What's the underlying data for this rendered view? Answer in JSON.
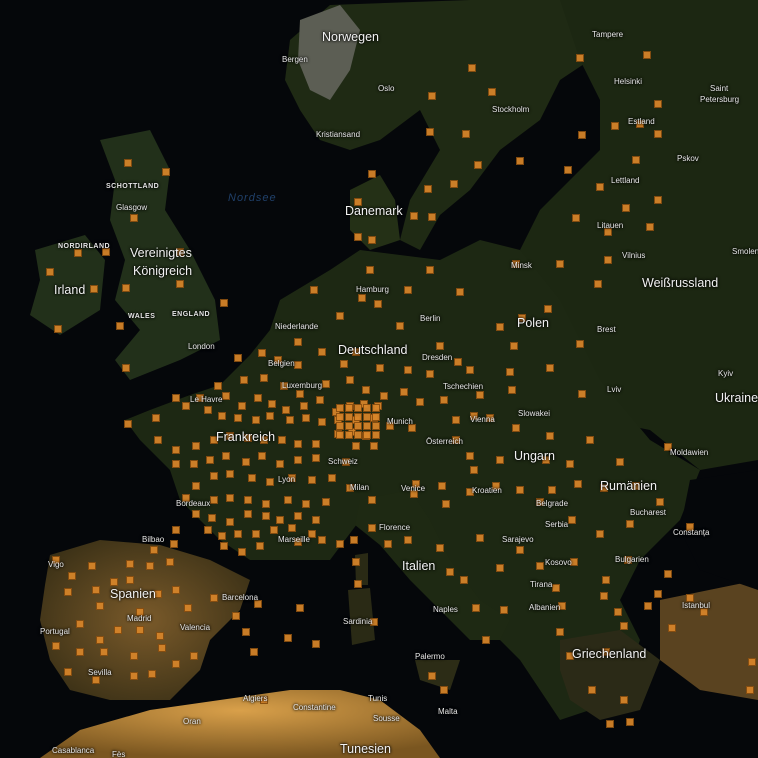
{
  "map": {
    "colors": {
      "ocean": "#05070a",
      "land": "#1e2a12",
      "marker": "#d9862a",
      "desert": "#8a6a30"
    },
    "labels": {
      "countries": [
        {
          "id": "norwegen",
          "text": "Norwegen"
        },
        {
          "id": "daenemark",
          "text": "Danemark"
        },
        {
          "id": "vereinigtes-koenigreich-1",
          "text": "Vereinigtes"
        },
        {
          "id": "vereinigtes-koenigreich-2",
          "text": "Königreich"
        },
        {
          "id": "irland",
          "text": "Irland"
        },
        {
          "id": "deutschland",
          "text": "Deutschland"
        },
        {
          "id": "frankreich",
          "text": "Frankreich"
        },
        {
          "id": "polen",
          "text": "Polen"
        },
        {
          "id": "weissrussland",
          "text": "Weißrussland"
        },
        {
          "id": "ukraine",
          "text": "Ukraine"
        },
        {
          "id": "ungarn",
          "text": "Ungarn"
        },
        {
          "id": "rumaenien",
          "text": "Rumänien"
        },
        {
          "id": "italien",
          "text": "Italien"
        },
        {
          "id": "spanien",
          "text": "Spanien"
        },
        {
          "id": "griechenland",
          "text": "Griechenland"
        },
        {
          "id": "tunesien",
          "text": "Tunesien"
        }
      ],
      "regions": [
        {
          "id": "schottland",
          "text": "SCHOTTLAND"
        },
        {
          "id": "nordirland",
          "text": "NORDIRLAND"
        },
        {
          "id": "wales",
          "text": "WALES"
        },
        {
          "id": "england",
          "text": "ENGLAND"
        }
      ],
      "seas": [
        {
          "id": "nordsee",
          "text": "Nordsee"
        }
      ],
      "cities": [
        {
          "id": "tampere",
          "text": "Tampere"
        },
        {
          "id": "bergen",
          "text": "Bergen"
        },
        {
          "id": "oslo",
          "text": "Oslo"
        },
        {
          "id": "helsinki",
          "text": "Helsinki"
        },
        {
          "id": "saint-petersburg-1",
          "text": "Saint"
        },
        {
          "id": "saint-petersburg-2",
          "text": "Petersburg"
        },
        {
          "id": "stockholm",
          "text": "Stockholm"
        },
        {
          "id": "estland",
          "text": "Estland"
        },
        {
          "id": "kristiansand",
          "text": "Kristiansand"
        },
        {
          "id": "pskov",
          "text": "Pskov"
        },
        {
          "id": "lettland",
          "text": "Lettland"
        },
        {
          "id": "glasgow",
          "text": "Glasgow"
        },
        {
          "id": "litauen",
          "text": "Litauen"
        },
        {
          "id": "smolensk",
          "text": "Smolen"
        },
        {
          "id": "vilnius",
          "text": "Vilnius"
        },
        {
          "id": "minsk",
          "text": "Minsk"
        },
        {
          "id": "hamburg",
          "text": "Hamburg"
        },
        {
          "id": "berlin",
          "text": "Berlin"
        },
        {
          "id": "niederlande",
          "text": "Niederlande"
        },
        {
          "id": "brest",
          "text": "Brest"
        },
        {
          "id": "london",
          "text": "London"
        },
        {
          "id": "belgien",
          "text": "Belgien"
        },
        {
          "id": "dresden",
          "text": "Dresden"
        },
        {
          "id": "luxemburg",
          "text": "Luxemburg"
        },
        {
          "id": "tschechien",
          "text": "Tschechien"
        },
        {
          "id": "kyiv",
          "text": "Kyiv"
        },
        {
          "id": "lviv",
          "text": "Lviv"
        },
        {
          "id": "le-havre",
          "text": "Le Havre"
        },
        {
          "id": "slowakei",
          "text": "Slowakei"
        },
        {
          "id": "munich",
          "text": "Munich"
        },
        {
          "id": "vienna",
          "text": "Vienna"
        },
        {
          "id": "oesterreich",
          "text": "Österreich"
        },
        {
          "id": "moldawien",
          "text": "Moldawien"
        },
        {
          "id": "schweiz",
          "text": "Schweiz"
        },
        {
          "id": "lyon",
          "text": "Lyon"
        },
        {
          "id": "milan",
          "text": "Milan"
        },
        {
          "id": "venice",
          "text": "Venice"
        },
        {
          "id": "kroatien",
          "text": "Kroatien"
        },
        {
          "id": "bordeaux",
          "text": "Bordeaux"
        },
        {
          "id": "belgrade",
          "text": "Belgrade"
        },
        {
          "id": "bucharest",
          "text": "Bucharest"
        },
        {
          "id": "florence",
          "text": "Florence"
        },
        {
          "id": "serbia",
          "text": "Serbia"
        },
        {
          "id": "constanta",
          "text": "Constanța"
        },
        {
          "id": "bilbao",
          "text": "Bilbao"
        },
        {
          "id": "marseille",
          "text": "Marseille"
        },
        {
          "id": "sarajevo",
          "text": "Sarajevo"
        },
        {
          "id": "kosovo",
          "text": "Kosovo"
        },
        {
          "id": "bulgarien",
          "text": "Bulgarien"
        },
        {
          "id": "vigo",
          "text": "Vigo"
        },
        {
          "id": "tirana",
          "text": "Tirana"
        },
        {
          "id": "barcelona",
          "text": "Barcelona"
        },
        {
          "id": "istanbul",
          "text": "Istanbul"
        },
        {
          "id": "naples",
          "text": "Naples"
        },
        {
          "id": "albanien",
          "text": "Albanien"
        },
        {
          "id": "madrid",
          "text": "Madrid"
        },
        {
          "id": "portugal",
          "text": "Portugal"
        },
        {
          "id": "valencia",
          "text": "Valencia"
        },
        {
          "id": "sardinia",
          "text": "Sardinia"
        },
        {
          "id": "palermo",
          "text": "Palermo"
        },
        {
          "id": "sevilla",
          "text": "Sevilla"
        },
        {
          "id": "algiers",
          "text": "Algiers"
        },
        {
          "id": "tunis",
          "text": "Tunis"
        },
        {
          "id": "constantine",
          "text": "Constantine"
        },
        {
          "id": "malta",
          "text": "Malta"
        },
        {
          "id": "oran",
          "text": "Oran"
        },
        {
          "id": "sousse",
          "text": "Sousse"
        },
        {
          "id": "casablanca",
          "text": "Casablanca"
        },
        {
          "id": "fes",
          "text": "Fès"
        }
      ]
    }
  }
}
